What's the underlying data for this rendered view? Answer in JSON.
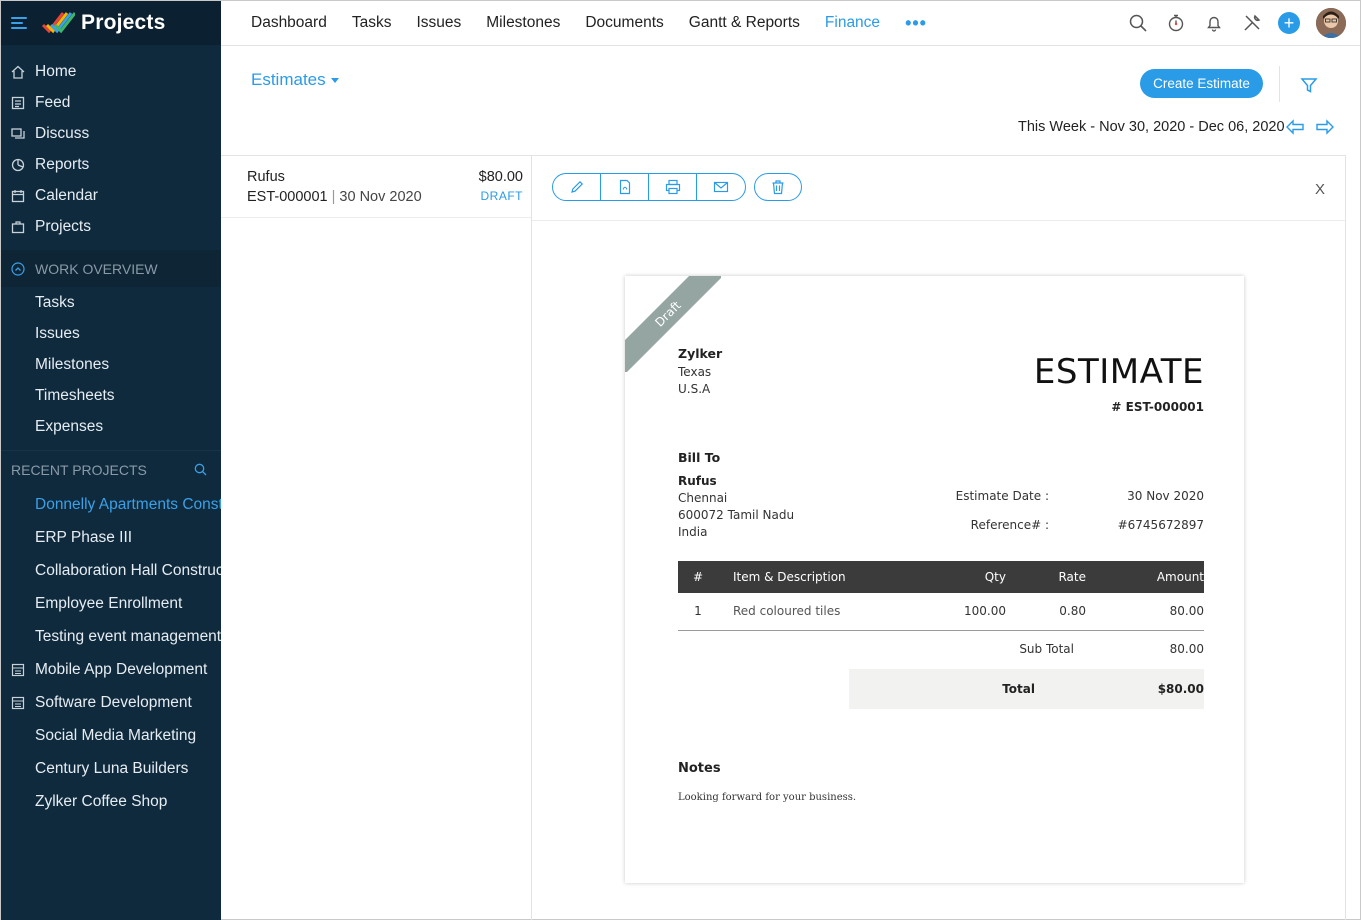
{
  "app": {
    "title": "Projects"
  },
  "sidebar": {
    "nav": [
      {
        "label": "Home",
        "icon": "home-icon"
      },
      {
        "label": "Feed",
        "icon": "feed-icon"
      },
      {
        "label": "Discuss",
        "icon": "discuss-icon"
      },
      {
        "label": "Reports",
        "icon": "reports-icon"
      },
      {
        "label": "Calendar",
        "icon": "calendar-icon"
      },
      {
        "label": "Projects",
        "icon": "projects-icon"
      }
    ],
    "work_overview": {
      "title": "WORK OVERVIEW",
      "items": [
        "Tasks",
        "Issues",
        "Milestones",
        "Timesheets",
        "Expenses"
      ]
    },
    "recent_projects": {
      "title": "RECENT PROJECTS",
      "items": [
        "Donnelly Apartments Construction",
        "ERP Phase III",
        "Collaboration Hall Construction",
        "Employee Enrollment",
        "Testing event management",
        "Mobile App Development",
        "Software Development",
        "Social Media Marketing",
        "Century Luna Builders",
        "Zylker Coffee Shop"
      ]
    }
  },
  "topbar": {
    "tabs": [
      "Dashboard",
      "Tasks",
      "Issues",
      "Milestones",
      "Documents",
      "Gantt & Reports",
      "Finance"
    ],
    "active_tab": "Finance",
    "more": "•••",
    "add_label": "+"
  },
  "header": {
    "view_selector": "Estimates",
    "create_button": "Create Estimate",
    "week_range": "This Week - Nov 30, 2020 - Dec 06, 2020"
  },
  "list": {
    "items": [
      {
        "customer": "Rufus",
        "amount": "$80.00",
        "number": "EST-000001",
        "date": "30 Nov 2020",
        "status": "DRAFT"
      }
    ]
  },
  "detail": {
    "close_label": "X",
    "ribbon": "Draft",
    "from": {
      "name": "Zylker",
      "line1": "Texas",
      "line2": "U.S.A"
    },
    "title": "ESTIMATE",
    "number": "# EST-000001",
    "bill_to": {
      "heading": "Bill To",
      "name": "Rufus",
      "line1": "Chennai",
      "line2": "600072 Tamil Nadu",
      "line3": "India"
    },
    "meta": {
      "date_label": "Estimate Date :",
      "date_value": "30 Nov 2020",
      "ref_label": "Reference# :",
      "ref_value": "#6745672897"
    },
    "table": {
      "headers": {
        "num": "#",
        "desc": "Item & Description",
        "qty": "Qty",
        "rate": "Rate",
        "amount": "Amount"
      },
      "rows": [
        {
          "num": "1",
          "desc": "Red coloured tiles",
          "qty": "100.00",
          "rate": "0.80",
          "amount": "80.00"
        }
      ]
    },
    "subtotal": {
      "label": "Sub Total",
      "value": "80.00"
    },
    "total": {
      "label": "Total",
      "value": "$80.00"
    },
    "notes": {
      "heading": "Notes",
      "text": "Looking forward for your business."
    }
  }
}
